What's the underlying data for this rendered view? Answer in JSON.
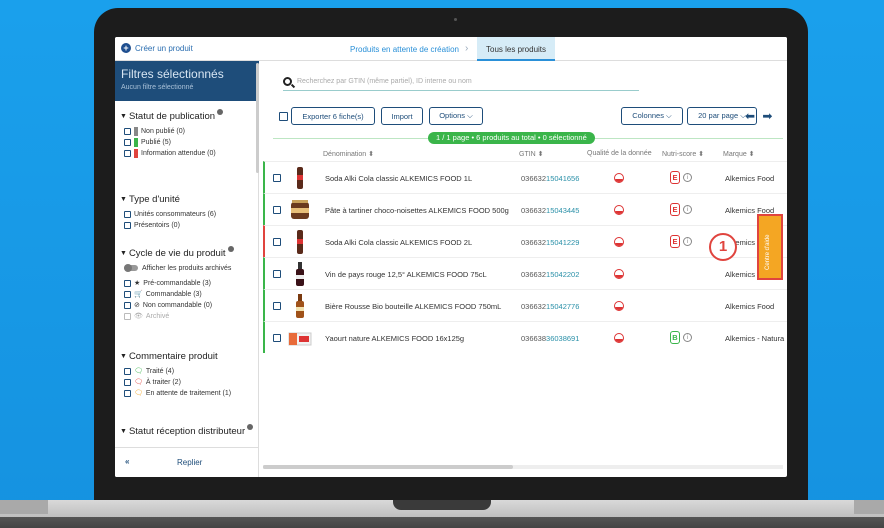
{
  "topbar": {
    "create_label": "Créer un produit",
    "crumb_pending": "Produits en attente de création",
    "crumb_all": "Tous les produits"
  },
  "sidebar": {
    "title": "Filtres sélectionnés",
    "subtitle": "Aucun filtre sélectionné",
    "publication": {
      "heading": "Statut de publication",
      "options": [
        {
          "label": "Non publié (0)",
          "color": "#888888"
        },
        {
          "label": "Publié (5)",
          "color": "#3ab54a"
        },
        {
          "label": "Information attendue (0)",
          "color": "#e0443e"
        }
      ]
    },
    "unit_type": {
      "heading": "Type d'unité",
      "options": [
        "Unités consommateurs (6)",
        "Présentoirs (0)"
      ]
    },
    "lifecycle": {
      "heading": "Cycle de vie du produit",
      "archive_toggle": "Afficher les produits archivés",
      "options": [
        {
          "icon": "star-icon",
          "glyph": "★",
          "label": "Pré-commandable (3)"
        },
        {
          "icon": "cart-icon",
          "glyph": "🛒",
          "label": "Commandable (3)"
        },
        {
          "icon": "block-icon",
          "glyph": "⊘",
          "label": "Non commandable (0)"
        },
        {
          "icon": "hidden-icon",
          "glyph": "👁",
          "label": "Archivé"
        }
      ]
    },
    "comment": {
      "heading": "Commentaire produit",
      "options": [
        {
          "label": "Traité (4)",
          "color": "#3ab54a"
        },
        {
          "label": "À traiter (2)",
          "color": "#e0443e"
        },
        {
          "label": "En attente de traitement (1)",
          "color": "#f4a623"
        }
      ]
    },
    "distributor_heading": "Statut réception distributeur",
    "collapse_label": "Replier",
    "collapse_glyph": "«"
  },
  "main": {
    "search_placeholder": "Recherchez par GTIN (même partiel), ID interne ou nom",
    "toolbar": {
      "export_label": "Exporter 6 fiche(s)",
      "import_label": "Import",
      "options_label": "Options ⌵",
      "columns_label": "Colonnes ⌵",
      "per_page_label": "20 par page ⌵",
      "arrows": "⬅ ➡"
    },
    "summary": "1 / 1 page • 6 produits au total • 0 sélectionné",
    "columns": {
      "name": "Dénomination ⬍",
      "gtin": "GTIN ⬍",
      "quality": "Qualité de la donnée",
      "nutri": "Nutri-score ⬍",
      "brand": "Marque ⬍"
    },
    "rows": [
      {
        "name": "Soda Alki Cola classic ALKEMICS FOOD 1L",
        "gtin_prefix": "036632",
        "gtin_suffix": "15041656",
        "nutri": "E",
        "brand": "Alkemics Food",
        "status": "green"
      },
      {
        "name": "Pâte à tartiner choco-noisettes ALKEMICS FOOD 500g",
        "gtin_prefix": "036632",
        "gtin_suffix": "15043445",
        "nutri": "E",
        "brand": "Alkemics Food",
        "status": "green"
      },
      {
        "name": "Soda Alki Cola classic ALKEMICS FOOD 2L",
        "gtin_prefix": "036632",
        "gtin_suffix": "15041229",
        "nutri": "E",
        "brand": "Alkemics Food",
        "status": "red"
      },
      {
        "name": "Vin de pays rouge 12,5° ALKEMICS FOOD 75cL",
        "gtin_prefix": "036632",
        "gtin_suffix": "15042202",
        "nutri": "",
        "brand": "Alkemics Food",
        "status": "green"
      },
      {
        "name": "Bière Rousse Bio bouteille ALKEMICS FOOD 750mL",
        "gtin_prefix": "036632",
        "gtin_suffix": "15042776",
        "nutri": "",
        "brand": "Alkemics Food",
        "status": "green"
      },
      {
        "name": "Yaourt nature ALKEMICS FOOD 16x125g",
        "gtin_prefix": "036638",
        "gtin_suffix": "36038691",
        "nutri": "B",
        "brand": "Alkemics - Natura",
        "status": "green"
      }
    ],
    "callout_number": "1",
    "side_tab_label": "Centre d'aide"
  }
}
